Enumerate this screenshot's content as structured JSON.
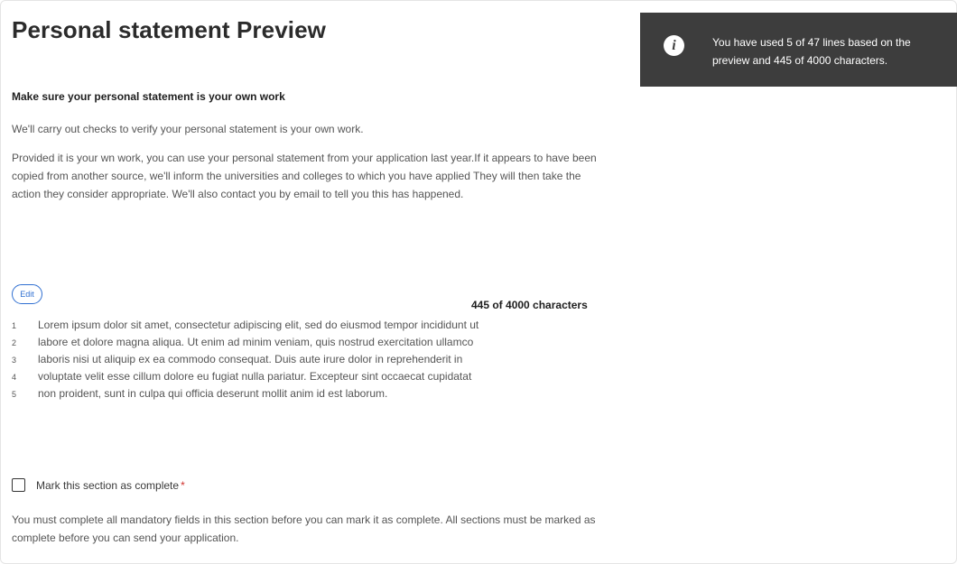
{
  "page": {
    "title": "Personal statement Preview"
  },
  "guidance": {
    "heading": "Make sure your personal statement is your own work",
    "paragraph1": "We'll carry out checks to verify your personal statement is your own work.",
    "paragraph2": "Provided it is your wn work, you can use your personal statement from your application last year.If it appears to have been copied from another source, we'll inform the universities and colleges to which you have applied They will then take the action they consider appropriate. We'll also contact you by email to tell you this has happened."
  },
  "info_box": {
    "icon": "info-icon",
    "glyph": "i",
    "text": "You have used 5 of 47 lines based on the preview and 445 of 4000 characters."
  },
  "statement": {
    "edit_label": "Edit",
    "char_count": "445 of 4000 characters",
    "lines": [
      {
        "number": "1",
        "text": "Lorem ipsum dolor sit amet, consectetur adipiscing elit, sed do eiusmod tempor incididunt ut"
      },
      {
        "number": "2",
        "text": "labore et dolore magna aliqua. Ut enim ad minim veniam, quis nostrud exercitation ullamco"
      },
      {
        "number": "3",
        "text": "laboris nisi ut aliquip ex ea commodo consequat. Duis aute irure dolor in reprehenderit in"
      },
      {
        "number": "4",
        "text": "voluptate velit esse cillum dolore eu fugiat nulla pariatur. Excepteur sint occaecat cupidatat"
      },
      {
        "number": "5",
        "text": "non proident, sunt in culpa qui officia deserunt mollit anim id est laborum."
      }
    ]
  },
  "complete": {
    "label": "Mark this section as complete",
    "required_marker": "*",
    "checked": false,
    "note": "You must complete all mandatory fields in this section before you can mark it as complete. All sections must be marked as complete before you can send your application."
  },
  "colors": {
    "info_bg": "#3d3d3d",
    "accent": "#2f6fd1",
    "required": "#d0312d"
  }
}
